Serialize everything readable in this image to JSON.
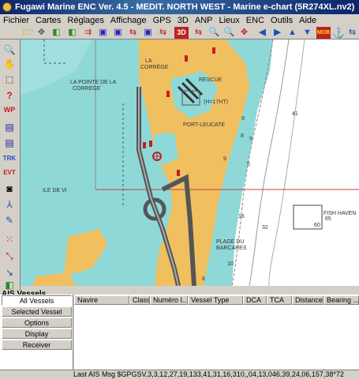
{
  "window": {
    "title": "Fugawi Marine ENC Ver. 4.5 - MEDIT. NORTH WEST - Marine e-chart  (5R274XL.nv2)"
  },
  "menu": [
    "Fichier",
    "Cartes",
    "Réglages",
    "Affichage",
    "GPS",
    "3D",
    "ANP",
    "Lieux",
    "ENC",
    "Outils",
    "Aide"
  ],
  "toolbar": {
    "view3d_label": "3D",
    "mob_label": "MOB"
  },
  "map": {
    "labels": {
      "pointe": "LA POINTE DE LA",
      "correge": "CORREGE",
      "la_corrège": "LA",
      "corrège2": "CORRÈGE",
      "rescue": "RESCUE",
      "height": "(H=17HT)",
      "port_leucate": "PORT-LEUCATE",
      "ile_de_vi": "ILE DE VI",
      "fish_haven": "FISH HAVEN",
      "plage": "PLAGE DU",
      "barcares": "BARCARES"
    },
    "soundings": [
      "41",
      "9",
      "5",
      "8",
      "9",
      "5",
      "16",
      "32",
      "60",
      "65",
      "10",
      "8"
    ]
  },
  "ais": {
    "title": "AIS Vessels",
    "buttons": [
      "All Vessels",
      "Selected Vessel",
      "Options",
      "Display",
      "Receiver"
    ],
    "columns": [
      "Navire",
      "Class",
      "Numéro I...",
      "Vessel Type",
      "DCA",
      "TCA",
      "Distance",
      "Bearing ..."
    ],
    "status": "Last AIS Msg $GPGSV,3,3,12,27,19,133,41,31,16,310,,04,13,046,39,24,06,157,38*72"
  },
  "colors": {
    "sea_shallow": "#8fd8d8",
    "land": "#f0c060",
    "deep_sea": "#ffffff",
    "road": "#606060"
  }
}
